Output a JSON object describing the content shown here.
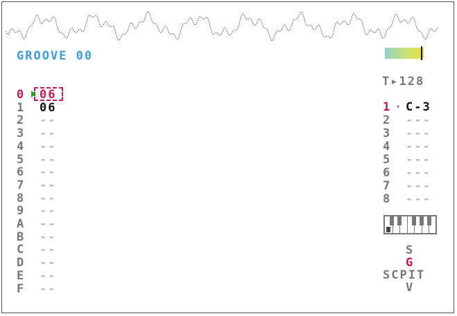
{
  "title": "GROOVE 00",
  "groove": {
    "row_numbers": [
      "0",
      "1",
      "2",
      "3",
      "4",
      "5",
      "6",
      "7",
      "8",
      "9",
      "A",
      "B",
      "C",
      "D",
      "E",
      "F"
    ],
    "values": [
      "06",
      "06",
      "--",
      "--",
      "--",
      "--",
      "--",
      "--",
      "--",
      "--",
      "--",
      "--",
      "--",
      "--",
      "--",
      "--"
    ],
    "active_row": 0
  },
  "tempo": "T▸128",
  "instrument": {
    "row_numbers": [
      "1",
      "2",
      "3",
      "4",
      "5",
      "6",
      "7",
      "8"
    ],
    "separator": "·",
    "notes": [
      "C-3",
      "---",
      "---",
      "---",
      "---",
      "---",
      "---",
      "---"
    ]
  },
  "screen_nav": {
    "up": "S",
    "current": "G",
    "row": "SCPIT",
    "down": "V"
  },
  "colors": {
    "accent": "#c2185b",
    "title": "#3c9ad6",
    "text": "#777777",
    "play": "#22aa22"
  }
}
